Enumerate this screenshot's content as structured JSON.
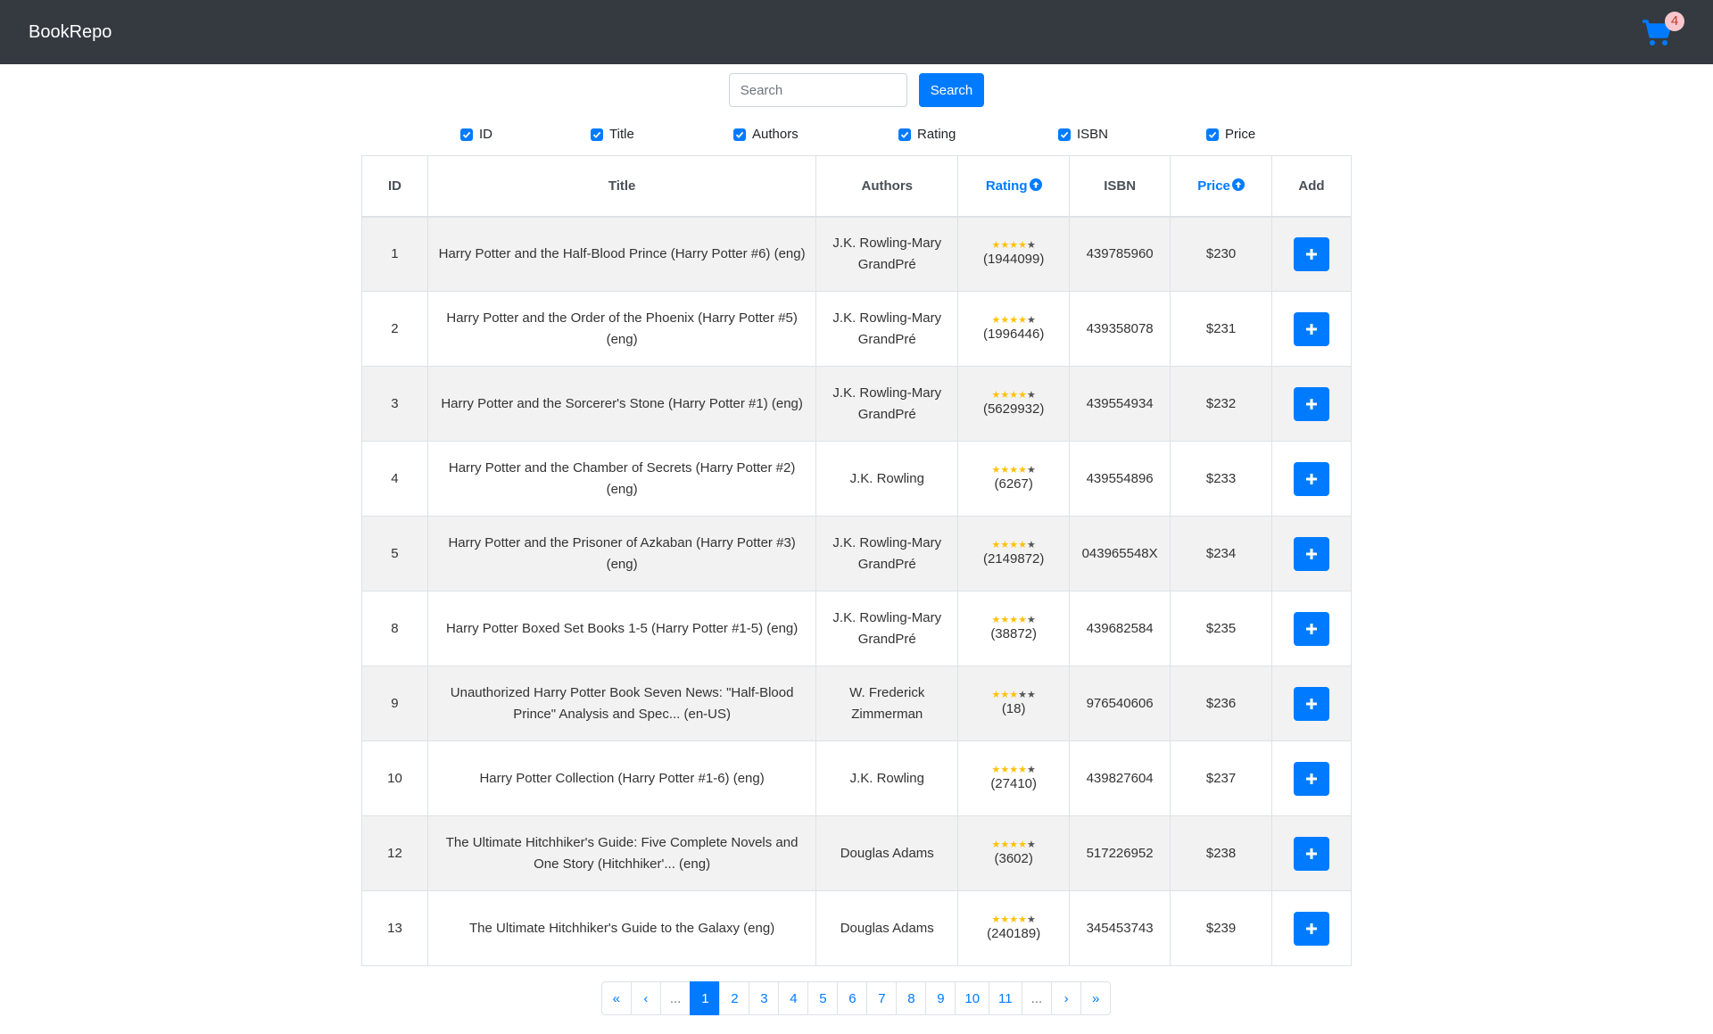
{
  "navbar": {
    "brand": "BookRepo",
    "cart_count": "4",
    "cart_icon": "shopping-cart-icon"
  },
  "search": {
    "placeholder": "Search",
    "value": "",
    "button_label": "Search"
  },
  "column_toggles": [
    {
      "label": "ID",
      "checked": true
    },
    {
      "label": "Title",
      "checked": true
    },
    {
      "label": "Authors",
      "checked": true
    },
    {
      "label": "Rating",
      "checked": true
    },
    {
      "label": "ISBN",
      "checked": true
    },
    {
      "label": "Price",
      "checked": true
    }
  ],
  "table": {
    "headers": {
      "id": "ID",
      "title": "Title",
      "authors": "Authors",
      "rating": "Rating",
      "isbn": "ISBN",
      "price": "Price",
      "add": "Add"
    },
    "sorted_columns": [
      "Rating",
      "Price"
    ],
    "rows": [
      {
        "id": "1",
        "title": "Harry Potter and the Half-Blood Prince (Harry Potter #6) (eng)",
        "authors": "J.K. Rowling-Mary GrandPré",
        "stars": 4,
        "count": "(1944099)",
        "isbn": "439785960",
        "price": "$230"
      },
      {
        "id": "2",
        "title": "Harry Potter and the Order of the Phoenix (Harry Potter #5) (eng)",
        "authors": "J.K. Rowling-Mary GrandPré",
        "stars": 4,
        "count": "(1996446)",
        "isbn": "439358078",
        "price": "$231"
      },
      {
        "id": "3",
        "title": "Harry Potter and the Sorcerer's Stone (Harry Potter #1) (eng)",
        "authors": "J.K. Rowling-Mary GrandPré",
        "stars": 4,
        "count": "(5629932)",
        "isbn": "439554934",
        "price": "$232"
      },
      {
        "id": "4",
        "title": "Harry Potter and the Chamber of Secrets (Harry Potter #2) (eng)",
        "authors": "J.K. Rowling",
        "stars": 4,
        "count": "(6267)",
        "isbn": "439554896",
        "price": "$233"
      },
      {
        "id": "5",
        "title": "Harry Potter and the Prisoner of Azkaban (Harry Potter #3) (eng)",
        "authors": "J.K. Rowling-Mary GrandPré",
        "stars": 4,
        "count": "(2149872)",
        "isbn": "043965548X",
        "price": "$234"
      },
      {
        "id": "8",
        "title": "Harry Potter Boxed Set Books 1-5 (Harry Potter #1-5) (eng)",
        "authors": "J.K. Rowling-Mary GrandPré",
        "stars": 4,
        "count": "(38872)",
        "isbn": "439682584",
        "price": "$235"
      },
      {
        "id": "9",
        "title": "Unauthorized Harry Potter Book Seven News: \"Half-Blood Prince\" Analysis and Spec... (en-US)",
        "authors": "W. Frederick Zimmerman",
        "stars": 3,
        "count": "(18)",
        "isbn": "976540606",
        "price": "$236"
      },
      {
        "id": "10",
        "title": "Harry Potter Collection (Harry Potter #1-6) (eng)",
        "authors": "J.K. Rowling",
        "stars": 4,
        "count": "(27410)",
        "isbn": "439827604",
        "price": "$237"
      },
      {
        "id": "12",
        "title": "The Ultimate Hitchhiker's Guide: Five Complete Novels and One Story (Hitchhiker'... (eng)",
        "authors": "Douglas Adams",
        "stars": 4,
        "count": "(3602)",
        "isbn": "517226952",
        "price": "$238"
      },
      {
        "id": "13",
        "title": "The Ultimate Hitchhiker's Guide to the Galaxy (eng)",
        "authors": "Douglas Adams",
        "stars": 4,
        "count": "(240189)",
        "isbn": "345453743",
        "price": "$239"
      }
    ]
  },
  "pagination": {
    "items": [
      "«",
      "‹",
      "...",
      "1",
      "2",
      "3",
      "4",
      "5",
      "6",
      "7",
      "8",
      "9",
      "10",
      "11",
      "...",
      "›",
      "»"
    ],
    "active": "1"
  },
  "colors": {
    "navbar_bg": "#343a40",
    "primary": "#007bff",
    "star": "#ffc107",
    "stripe": "#f2f2f2"
  }
}
